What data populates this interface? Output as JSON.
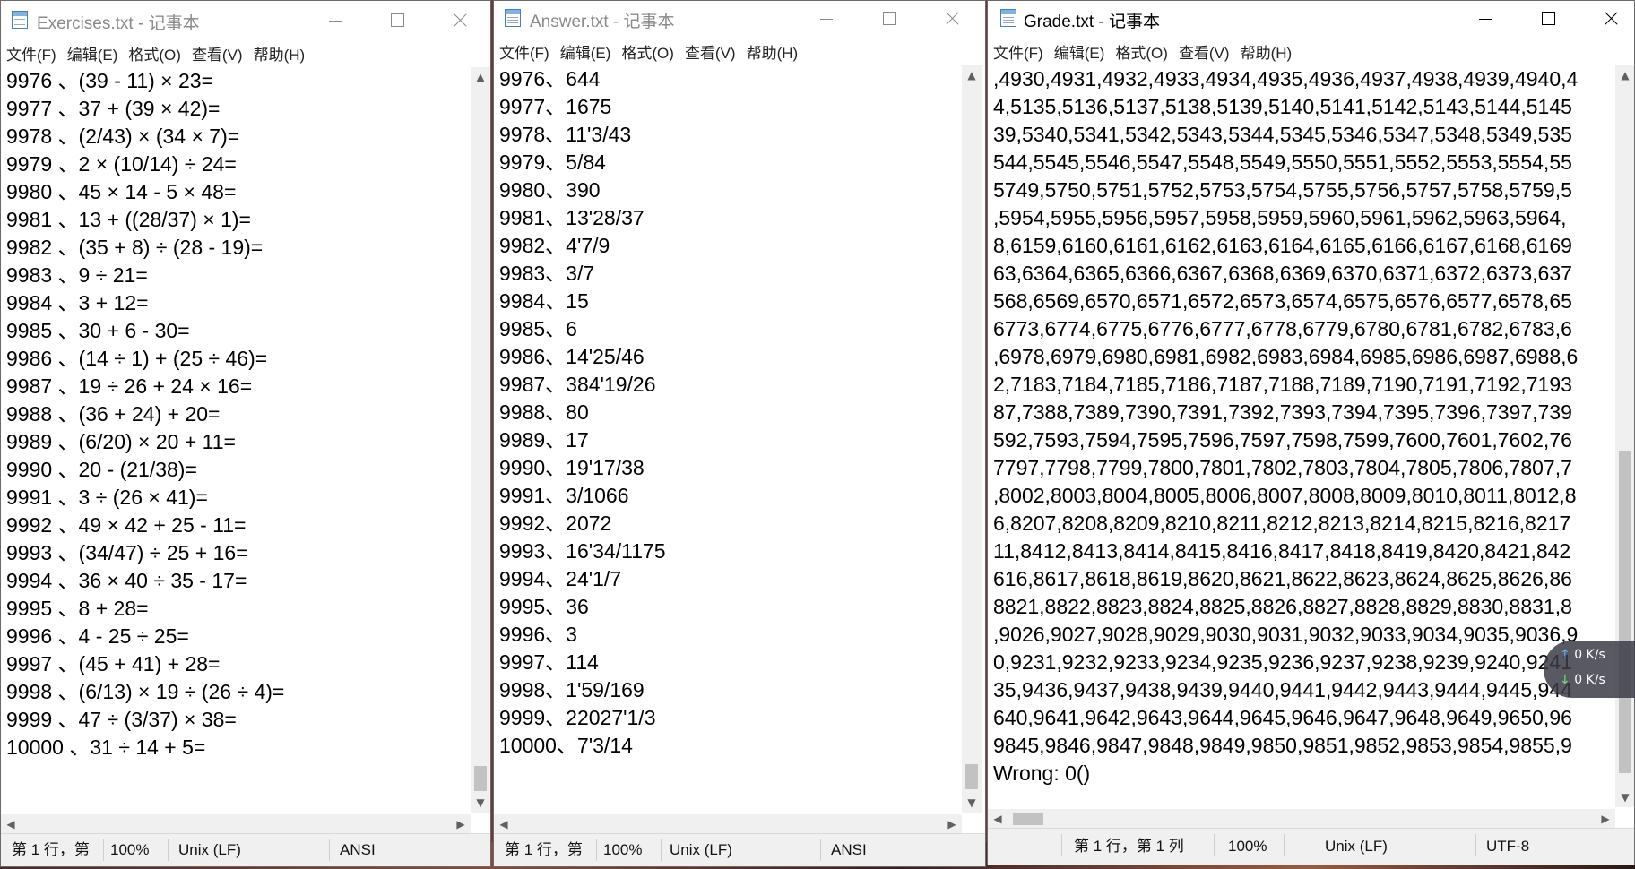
{
  "menu": [
    "文件(F)",
    "编辑(E)",
    "格式(O)",
    "查看(V)",
    "帮助(H)"
  ],
  "windows": {
    "exercises": {
      "title": "Exercises.txt - 记事本",
      "lines": [
        "9976 、(39 - 11) × 23=",
        "9977 、37 + (39 × 42)=",
        "9978 、(2/43) × (34 × 7)=",
        "9979 、2 × (10/14) ÷ 24=",
        "9980 、45 × 14 - 5 × 48=",
        "9981 、13 + ((28/37) × 1)=",
        "9982 、(35 + 8) ÷ (28 - 19)=",
        "9983 、9 ÷ 21=",
        "9984 、3 + 12=",
        "9985 、30 + 6 - 30=",
        "9986 、(14 ÷ 1) + (25 ÷ 46)=",
        "9987 、19 ÷ 26 + 24 × 16=",
        "9988 、(36 + 24) + 20=",
        "9989 、(6/20) × 20 + 11=",
        "9990 、20 - (21/38)=",
        "9991 、3 ÷ (26 × 41)=",
        "9992 、49 × 42 + 25 - 11=",
        "9993 、(34/47) ÷ 25 + 16=",
        "9994 、36 × 40 ÷ 35 - 17=",
        "9995 、8 + 28=",
        "9996 、4 - 25 ÷ 25=",
        "9997 、(45 + 41) + 28=",
        "9998 、(6/13) × 19 ÷ (26 ÷ 4)=",
        "9999 、47 ÷ (3/37) × 38=",
        "10000 、31 ÷ 14 + 5="
      ],
      "status": {
        "position": "第 1 行，第",
        "zoom": "100%",
        "eol": "Unix (LF)",
        "encoding": "ANSI"
      }
    },
    "answer": {
      "title": "Answer.txt - 记事本",
      "lines": [
        "9976、644",
        "9977、1675",
        "9978、11'3/43",
        "9979、5/84",
        "9980、390",
        "9981、13'28/37",
        "9982、4'7/9",
        "9983、3/7",
        "9984、15",
        "9985、6",
        "9986、14'25/46",
        "9987、384'19/26",
        "9988、80",
        "9989、17",
        "9990、19'17/38",
        "9991、3/1066",
        "9992、2072",
        "9993、16'34/1175",
        "9994、24'1/7",
        "9995、36",
        "9996、3",
        "9997、114",
        "9998、1'59/169",
        "9999、22027'1/3",
        "10000、7'3/14"
      ],
      "status": {
        "position": "第 1 行，第",
        "zoom": "100%",
        "eol": "Unix (LF)",
        "encoding": "ANSI"
      }
    },
    "grade": {
      "title": "Grade.txt - 记事本",
      "lines": [
        ",4930,4931,4932,4933,4934,4935,4936,4937,4938,4939,4940,4",
        "4,5135,5136,5137,5138,5139,5140,5141,5142,5143,5144,5145",
        "39,5340,5341,5342,5343,5344,5345,5346,5347,5348,5349,535",
        "544,5545,5546,5547,5548,5549,5550,5551,5552,5553,5554,55",
        "5749,5750,5751,5752,5753,5754,5755,5756,5757,5758,5759,5",
        ",5954,5955,5956,5957,5958,5959,5960,5961,5962,5963,5964,",
        "8,6159,6160,6161,6162,6163,6164,6165,6166,6167,6168,6169",
        "63,6364,6365,6366,6367,6368,6369,6370,6371,6372,6373,637",
        "568,6569,6570,6571,6572,6573,6574,6575,6576,6577,6578,65",
        "6773,6774,6775,6776,6777,6778,6779,6780,6781,6782,6783,6",
        ",6978,6979,6980,6981,6982,6983,6984,6985,6986,6987,6988,6",
        "2,7183,7184,7185,7186,7187,7188,7189,7190,7191,7192,7193",
        "87,7388,7389,7390,7391,7392,7393,7394,7395,7396,7397,739",
        "592,7593,7594,7595,7596,7597,7598,7599,7600,7601,7602,76",
        "7797,7798,7799,7800,7801,7802,7803,7804,7805,7806,7807,7",
        ",8002,8003,8004,8005,8006,8007,8008,8009,8010,8011,8012,8",
        "6,8207,8208,8209,8210,8211,8212,8213,8214,8215,8216,8217",
        "11,8412,8413,8414,8415,8416,8417,8418,8419,8420,8421,842",
        "616,8617,8618,8619,8620,8621,8622,8623,8624,8625,8626,86",
        "8821,8822,8823,8824,8825,8826,8827,8828,8829,8830,8831,8",
        ",9026,9027,9028,9029,9030,9031,9032,9033,9034,9035,9036,9",
        "0,9231,9232,9233,9234,9235,9236,9237,9238,9239,9240,9241",
        "35,9436,9437,9438,9439,9440,9441,9442,9443,9444,9445,944",
        "640,9641,9642,9643,9644,9645,9646,9647,9648,9649,9650,96",
        "9845,9846,9847,9848,9849,9850,9851,9852,9853,9854,9855,9",
        "Wrong:  0()"
      ],
      "status": {
        "position": "第 1 行，第 1 列",
        "zoom": "100%",
        "eol": "Unix (LF)",
        "encoding": "UTF-8"
      }
    }
  },
  "net_widget": {
    "upload": "0 K/s",
    "download": "0 K/s"
  },
  "icons": [
    "notepad-icon",
    "minimize-icon",
    "maximize-icon",
    "close-icon",
    "scroll-arrow-icon",
    "upload-arrow-icon",
    "download-arrow-icon"
  ]
}
